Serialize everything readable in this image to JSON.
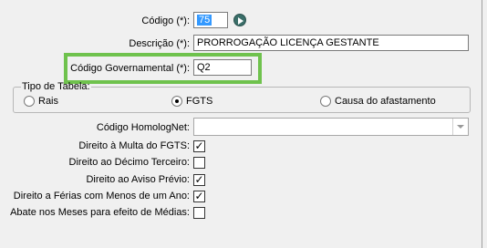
{
  "form": {
    "codigo": {
      "label": "Código (*):",
      "value": "75"
    },
    "descricao": {
      "label": "Descrição (*):",
      "value": "PRORROGAÇÃO LICENÇA GESTANTE"
    },
    "codigo_governamental": {
      "label": "Código Governamental (*):",
      "value": "Q2"
    },
    "tipo_tabela": {
      "legend": "Tipo de Tabela:",
      "options": [
        {
          "label": "Rais",
          "selected": false
        },
        {
          "label": "FGTS",
          "selected": true
        },
        {
          "label": "Causa do afastamento",
          "selected": false
        }
      ]
    },
    "codigo_homolognet": {
      "label": "Código HomologNet:",
      "value": ""
    },
    "checks": [
      {
        "label": "Direito à Multa do FGTS:",
        "checked": true
      },
      {
        "label": "Direito ao Décimo Terceiro:",
        "checked": false
      },
      {
        "label": "Direito ao Aviso Prévio:",
        "checked": true
      },
      {
        "label": "Direito a Férias com Menos de um Ano:",
        "checked": true
      },
      {
        "label": "Abate nos Meses para efeito de Médias:",
        "checked": false
      }
    ]
  },
  "icons": {
    "go": "go-arrow-icon"
  },
  "colors": {
    "highlight": "#6fc24d",
    "selection": "#3399ff"
  }
}
